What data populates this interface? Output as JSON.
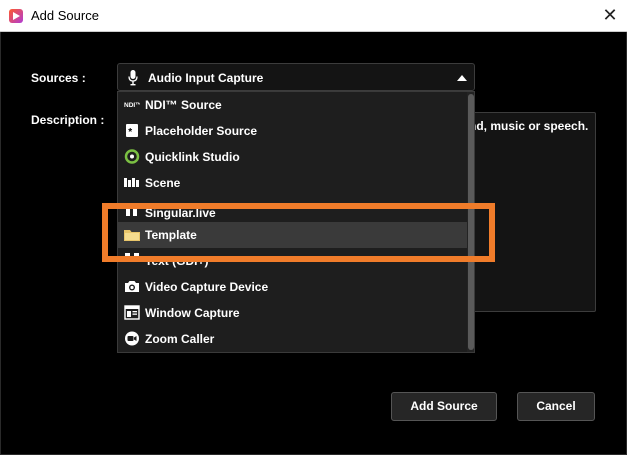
{
  "window": {
    "title": "Add Source",
    "close_glyph": "✕"
  },
  "form": {
    "sources_label": "Sources :",
    "description_label": "Description :",
    "selected_source": "Audio Input Capture",
    "description_text": "nd, music or speech."
  },
  "dropdown": {
    "items": [
      {
        "label": "NDI™ Source",
        "icon": "ndi-icon"
      },
      {
        "label": "Placeholder Source",
        "icon": "asterisk-icon"
      },
      {
        "label": "Quicklink Studio",
        "icon": "quicklink-icon"
      },
      {
        "label": "Scene",
        "icon": "scene-icon"
      },
      {
        "label": "Singular.live",
        "icon": "singular-icon"
      },
      {
        "label": "Template",
        "icon": "folder-icon",
        "highlighted": true
      },
      {
        "label": "Text (GDI+)",
        "icon": "text-icon"
      },
      {
        "label": "Video Capture Device",
        "icon": "camera-icon"
      },
      {
        "label": "Window Capture",
        "icon": "window-icon"
      },
      {
        "label": "Zoom Caller",
        "icon": "zoom-icon"
      }
    ]
  },
  "buttons": {
    "add_source": "Add Source",
    "cancel": "Cancel"
  },
  "colors": {
    "highlight": "#f07c2a",
    "background": "#000000",
    "hover": "#3a3a3a"
  }
}
